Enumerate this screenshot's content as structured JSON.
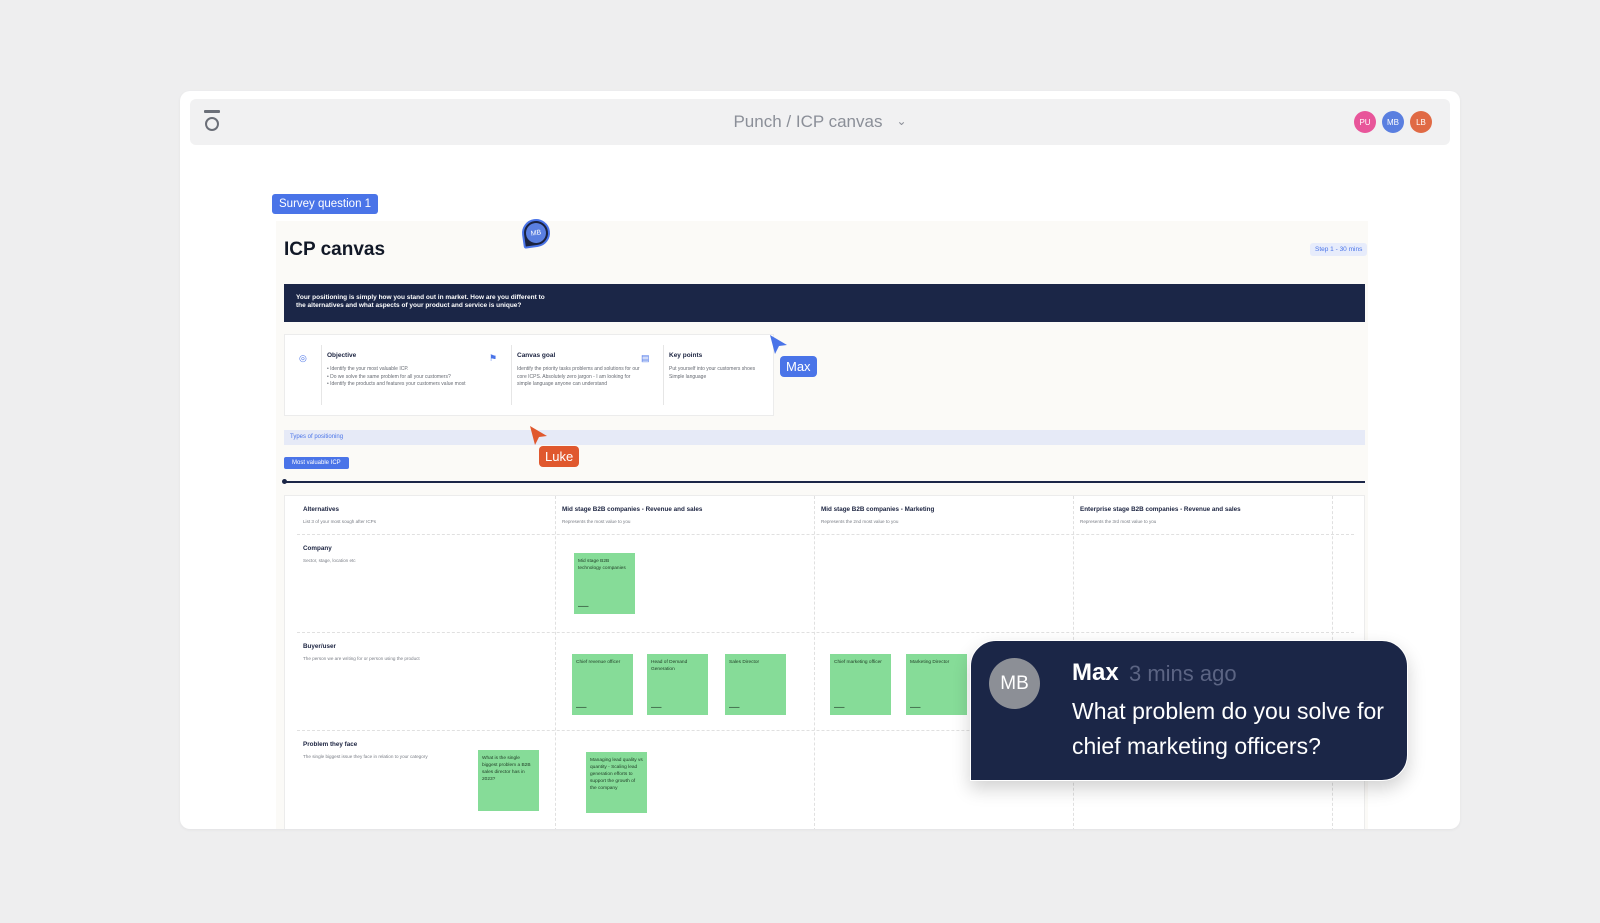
{
  "header": {
    "board_title": "Punch / ICP canvas",
    "avatars": [
      {
        "initials": "PU",
        "color": "#e8559a"
      },
      {
        "initials": "MB",
        "color": "#5a7fe0"
      },
      {
        "initials": "LB",
        "color": "#e06a45"
      }
    ]
  },
  "canvas": {
    "survey_tag": "Survey question 1",
    "presence_pin": "MB",
    "heading": "ICP canvas",
    "step_badge": "Step 1 - 30 mins",
    "banner_text": "Your positioning is simply how you stand out in market. How are you different to the alternatives and what aspects of your product and service is unique?",
    "info": [
      {
        "icon": "target-icon",
        "title": "Objective",
        "text": "• Identify the your most valuable ICP.\n• Do we solve the same problem for all your customers?\n• Identify the products and features your customers value most"
      },
      {
        "icon": "flag-icon",
        "title": "Canvas goal",
        "text": "Identify the priority tasks problems and solutions for our core ICPS. Absolutely zero jargon - I am looking for simple language anyone can understand"
      },
      {
        "icon": "document-icon",
        "title": "Key points",
        "text": "Put yourself into your customers shoes\nSimple language"
      }
    ],
    "types_bar": "Types of positioning",
    "mvicp_tag": "Most valuable ICP",
    "columns": [
      {
        "title": "Alternatives",
        "sub": "List 3 of your most sough after ICPs"
      },
      {
        "title": "Mid stage B2B companies - Revenue and sales",
        "sub": "Represents the most value to you"
      },
      {
        "title": "Mid stage B2B companies - Marketing",
        "sub": "Represents the 2nd most value to you"
      },
      {
        "title": "Enterprise stage B2B companies - Revenue and sales",
        "sub": "Represents the 3rd most value to you"
      }
    ],
    "rows": [
      {
        "title": "Company",
        "sub": "Sector, stage, location etc"
      },
      {
        "title": "Buyer/user",
        "sub": "The person we are writing for or person using the product"
      },
      {
        "title": "Problem they face",
        "sub": "The single biggest issue they face in relation to your category"
      }
    ],
    "stickies": {
      "s1": "Mid stage B2B technology companies",
      "s2": "Chief revenue officer",
      "s3": "Head of Demand Generation",
      "s4": "Sales Director",
      "s5": "Chief marketing officer",
      "s6": "Marketing Director",
      "s7": "What is the single biggest problem a B2B sales director has in 2023?",
      "s8": "Managing lead quality vs quantity - Scaling lead generation efforts to support the growth of the company"
    }
  },
  "cursors": {
    "max": {
      "label": "Max",
      "color": "#4a74e8"
    },
    "luke": {
      "label": "Luke",
      "color": "#e0582e"
    }
  },
  "comment": {
    "avatar": "MB",
    "author": "Max",
    "time": "3 mins ago",
    "message": "What problem do you solve for chief marketing officers?"
  }
}
